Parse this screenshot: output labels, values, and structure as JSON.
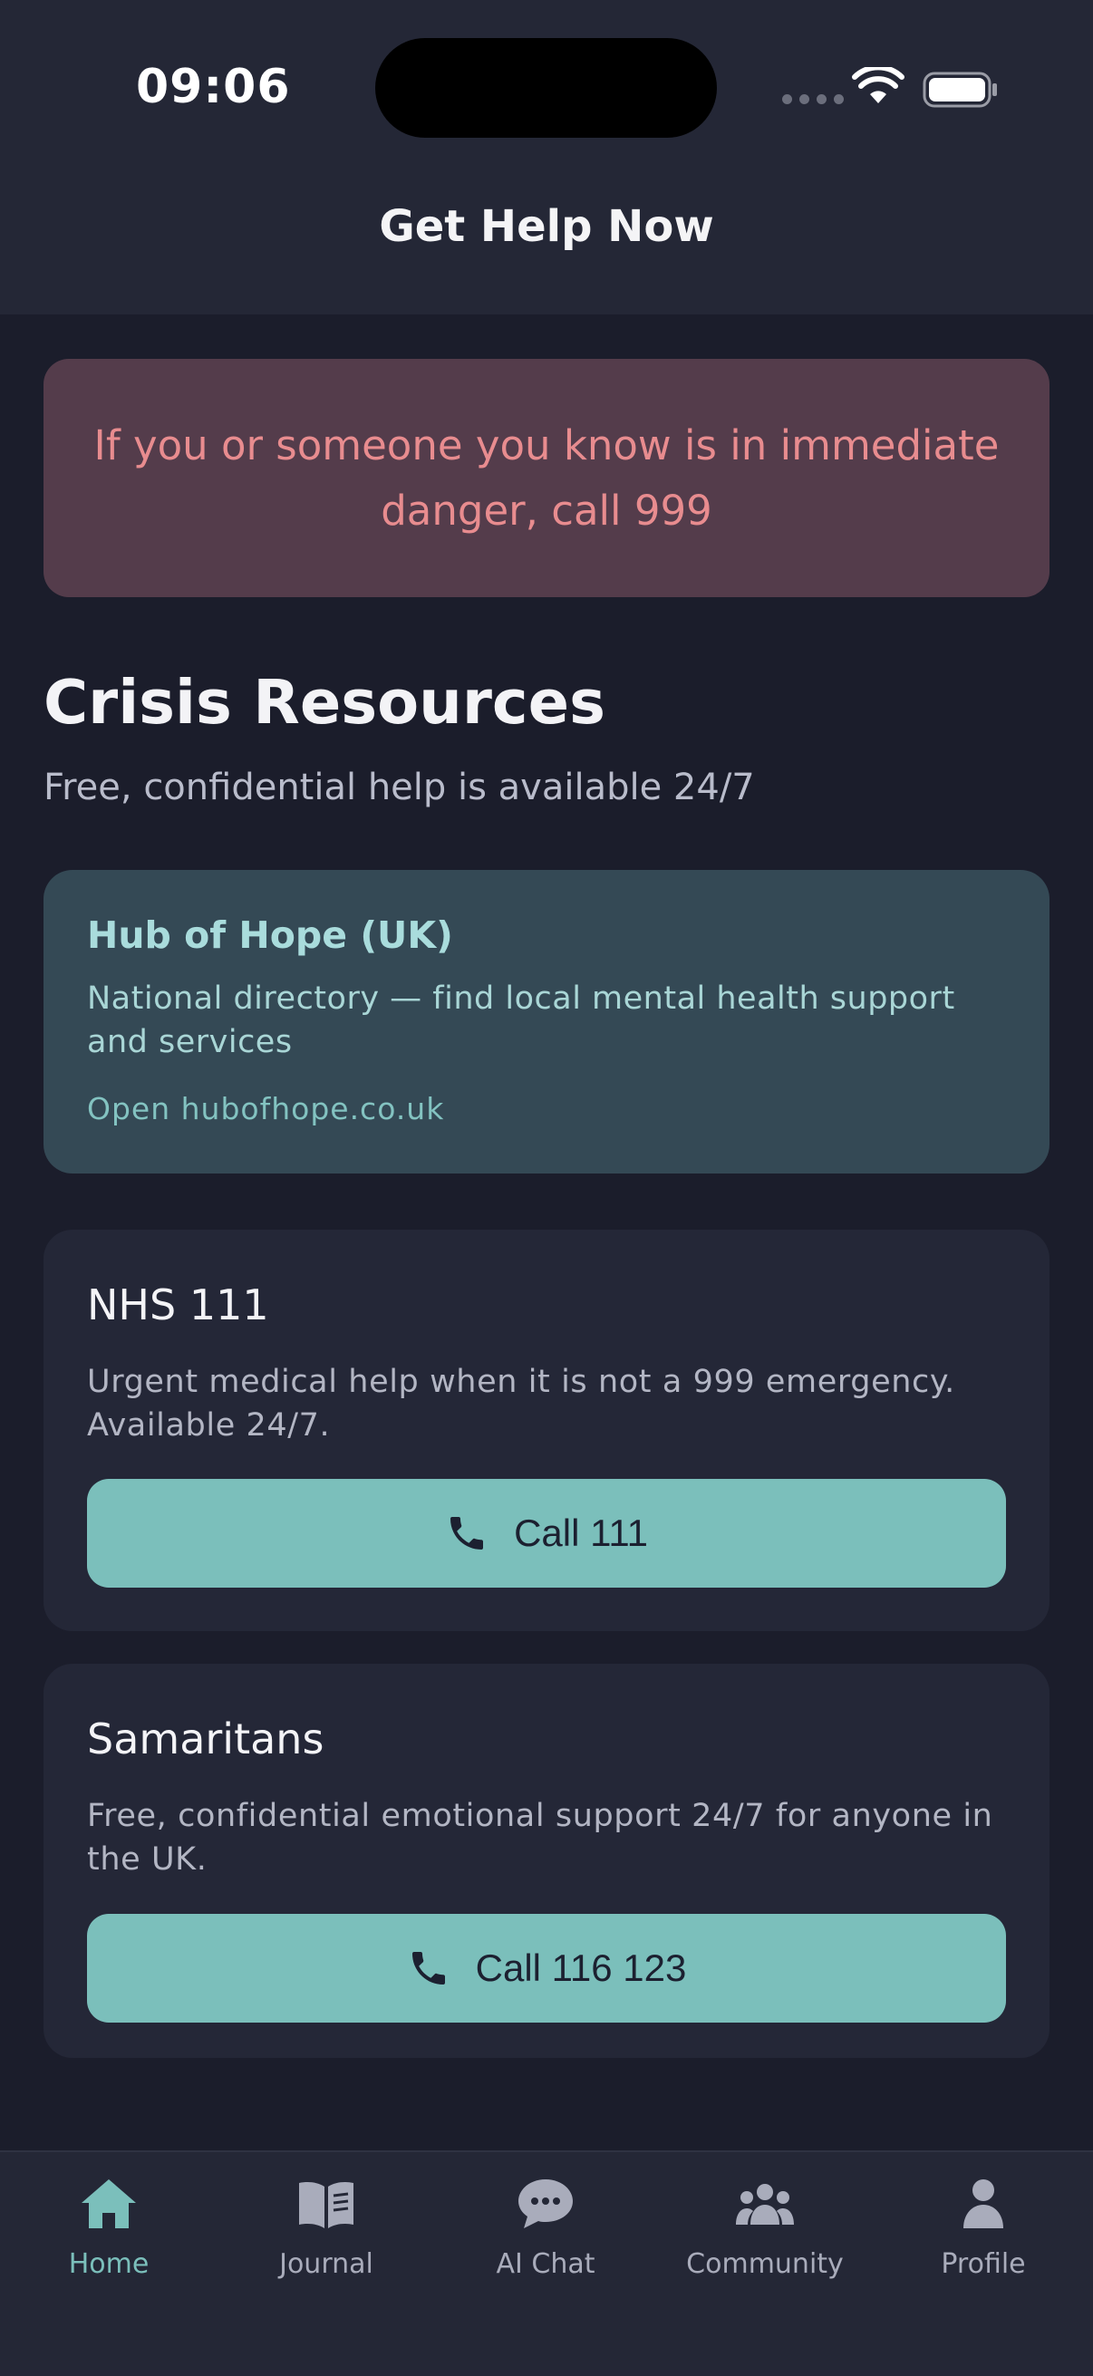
{
  "status_bar": {
    "time": "09:06"
  },
  "header": {
    "title": "Get Help Now"
  },
  "emergency": {
    "text": "If you or someone you know is in immediate danger, call 999",
    "color": "#e88c8f"
  },
  "section": {
    "title": "Crisis Resources",
    "subtitle": "Free, confidential help is available 24/7"
  },
  "hub_of_hope": {
    "title": "Hub of Hope (UK)",
    "description": "National directory — find local mental health support and services",
    "link": "Open hubofhope.co.uk"
  },
  "services": [
    {
      "title": "NHS 111",
      "description": "Urgent medical help when it is not a 999 emergency. Available 24/7.",
      "button_label": "Call 111",
      "icon": "phone-icon"
    },
    {
      "title": "Samaritans",
      "description": "Free, confidential emotional support 24/7 for anyone in the UK.",
      "button_label": "Call 116 123",
      "icon": "phone-icon"
    }
  ],
  "nav": {
    "active": "Home",
    "accent_color": "#7bbfbb",
    "items": [
      {
        "label": "Home",
        "icon": "home-icon"
      },
      {
        "label": "Journal",
        "icon": "book-icon"
      },
      {
        "label": "AI Chat",
        "icon": "chat-bubble-icon"
      },
      {
        "label": "Community",
        "icon": "people-icon"
      },
      {
        "label": "Profile",
        "icon": "person-icon"
      }
    ]
  }
}
